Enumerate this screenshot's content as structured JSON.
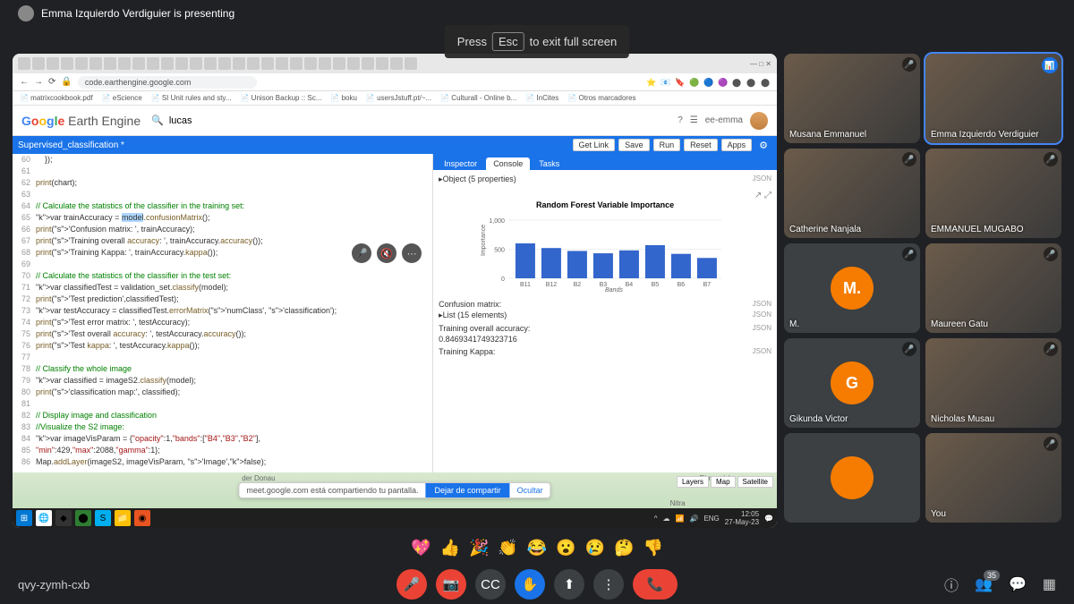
{
  "presenter_bar": "Emma Izquierdo Verdiguier is presenting",
  "esc_hint": {
    "pre": "Press",
    "key": "Esc",
    "post": "to exit full screen"
  },
  "browser": {
    "url": "code.earthengine.google.com",
    "bookmarks": [
      "matrixcookbook.pdf",
      "eScience",
      "SI Unit rules and sty...",
      "Unison Backup :: Sc...",
      "boku",
      "usersJstuff.pt/~...",
      "Culturall - Online b...",
      "InCites",
      "Otros marcadores"
    ]
  },
  "gee": {
    "logo_rest": "Earth Engine",
    "search_value": "lucas",
    "user": "ee-emma",
    "tab_name": "Supervised_classification *",
    "buttons": {
      "getlink": "Get Link",
      "save": "Save",
      "run": "Run",
      "reset": "Reset",
      "apps": "Apps"
    }
  },
  "code_lines": [
    {
      "n": 60,
      "t": "    });"
    },
    {
      "n": 61,
      "t": ""
    },
    {
      "n": 62,
      "t": "print(chart);"
    },
    {
      "n": 63,
      "t": ""
    },
    {
      "n": 64,
      "t": "// Calculate the statistics of the classifier in the training set:",
      "cls": "c"
    },
    {
      "n": 65,
      "t": "var trainAccuracy = model.confusionMatrix();",
      "hl": "model"
    },
    {
      "n": 66,
      "t": "print('Confusion matrix: ', trainAccuracy);"
    },
    {
      "n": 67,
      "t": "print('Training overall accuracy: ', trainAccuracy.accuracy());"
    },
    {
      "n": 68,
      "t": "print('Training Kappa: ', trainAccuracy.kappa());"
    },
    {
      "n": 69,
      "t": ""
    },
    {
      "n": 70,
      "t": "// Calculate the statistics of the classifier in the test set:",
      "cls": "c"
    },
    {
      "n": 71,
      "t": "var classifiedTest = validation_set.classify(model);"
    },
    {
      "n": 72,
      "t": "print('Test prediction',classifiedTest);"
    },
    {
      "n": 73,
      "t": "var testAccuracy = classifiedTest.errorMatrix('numClass', 'classification');"
    },
    {
      "n": 74,
      "t": "print('Test error matrix: ', testAccuracy);"
    },
    {
      "n": 75,
      "t": "print('Test overall accuracy: ', testAccuracy.accuracy());"
    },
    {
      "n": 76,
      "t": "print('Test kappa: ', testAccuracy.kappa());"
    },
    {
      "n": 77,
      "t": ""
    },
    {
      "n": 78,
      "t": "// Classify the whole image",
      "cls": "c"
    },
    {
      "n": 79,
      "t": "var classified = imageS2.classify(model);"
    },
    {
      "n": 80,
      "t": "print('classification map:', classified);"
    },
    {
      "n": 81,
      "t": ""
    },
    {
      "n": 82,
      "t": "// Display image and classification",
      "cls": "c"
    },
    {
      "n": 83,
      "t": "//Visualize the S2 image:",
      "cls": "c"
    },
    {
      "n": 84,
      "t": "var imageVisParam = {\"opacity\":1,\"bands\":[\"B4\",\"B3\",\"B2\"],"
    },
    {
      "n": 85,
      "t": "\"min\":429,\"max\":2088,\"gamma\":1};"
    },
    {
      "n": 86,
      "t": "Map.addLayer(imageS2, imageVisParam, 'Image',false);"
    }
  ],
  "console": {
    "tabs": {
      "inspector": "Inspector",
      "console": "Console",
      "tasks": "Tasks"
    },
    "rows": [
      {
        "t": "▸Object (5 properties)",
        "j": "JSON"
      }
    ],
    "chart_title": "Random Forest Variable Importance",
    "after": [
      {
        "t": "Confusion matrix:",
        "j": "JSON"
      },
      {
        "t": "▸List (15 elements)",
        "j": "JSON"
      },
      {
        "t": "",
        "j": ""
      },
      {
        "t": "Training overall accuracy:",
        "j": "JSON"
      },
      {
        "t": "0.8469341749323716",
        "j": ""
      },
      {
        "t": "",
        "j": ""
      },
      {
        "t": "Training Kappa:",
        "j": "JSON"
      }
    ]
  },
  "chart_data": {
    "type": "bar",
    "title": "Random Forest Variable Importance",
    "xlabel": "Bands",
    "ylabel": "Importance",
    "categories": [
      "B11",
      "B12",
      "B2",
      "B3",
      "B4",
      "B5",
      "B6",
      "B7"
    ],
    "values": [
      600,
      520,
      470,
      430,
      480,
      570,
      420,
      350
    ],
    "ylim": [
      0,
      1000
    ],
    "yticks": [
      0,
      500,
      1000
    ]
  },
  "share_notice": {
    "text": "meet.google.com está compartiendo tu pantalla.",
    "stop": "Dejar de compartir",
    "hide": "Ocultar"
  },
  "map": {
    "layers": "Layers",
    "map_btn": "Map",
    "sat_btn": "Satellite",
    "labels": [
      "der Donau",
      "Rimavská",
      "Nitra"
    ]
  },
  "taskbar": {
    "lang": "ENG",
    "time": "12:05",
    "date": "27-May-23"
  },
  "participants": [
    {
      "name": "Musana Emmanuel",
      "type": "img",
      "muted": true
    },
    {
      "name": "Emma Izquierdo Verdiguier",
      "type": "img",
      "speaking": true
    },
    {
      "name": "Catherine Nanjala",
      "type": "img",
      "muted": true
    },
    {
      "name": "EMMANUEL MUGABO",
      "type": "img",
      "muted": true
    },
    {
      "name": "M.",
      "type": "initial",
      "initial": "M.",
      "color": "#f57c00",
      "muted": true
    },
    {
      "name": "Maureen Gatu",
      "type": "img",
      "muted": true
    },
    {
      "name": "Gikunda Victor",
      "type": "initial",
      "initial": "G",
      "color": "#f57c00",
      "muted": true
    },
    {
      "name": "Nicholas Musau",
      "type": "img",
      "muted": true
    },
    {
      "name": "",
      "type": "initial",
      "initial": "",
      "color": "#f57c00",
      "muted": false,
      "half": true
    },
    {
      "name": "You",
      "type": "img",
      "muted": true,
      "half": true
    }
  ],
  "reactions": [
    "💖",
    "👍",
    "🎉",
    "👏",
    "😂",
    "😮",
    "😢",
    "🤔",
    "👎"
  ],
  "meet_code": "qvy-zymh-cxb",
  "participant_count": "35"
}
